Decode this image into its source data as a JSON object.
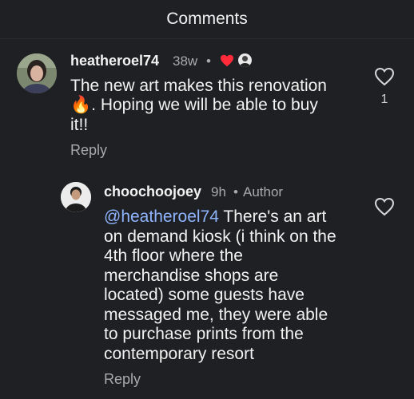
{
  "header": {
    "title": "Comments"
  },
  "comments": [
    {
      "username": "heatheroel74",
      "time": "38w",
      "separator": "•",
      "text_line1": "The new art makes this renovation",
      "text_line2_emoji": "🔥",
      "text_line2": ". Hoping we will be able to buy",
      "text_line3": "it!!",
      "reply_label": "Reply",
      "like_count": "1"
    },
    {
      "username": "choochoojoey",
      "time": "9h",
      "separator": "•",
      "author_label": "Author",
      "mention": "@heatheroel74",
      "text_line1_rest": " There's an art",
      "text_line2": "on demand kiosk (i think on the",
      "text_line3": "4th floor where the",
      "text_line4": "merchandise shops are",
      "text_line5": "located) some guests have",
      "text_line6": "messaged me, they were able",
      "text_line7": "to purchase prints from the",
      "text_line8": "contemporary resort",
      "reply_label": "Reply"
    }
  ],
  "icons": {
    "heart_filled_color": "#ff2b3a",
    "outline_heart": "heart-outline-icon",
    "author_like_badge": "author-avatar-badge-icon"
  }
}
